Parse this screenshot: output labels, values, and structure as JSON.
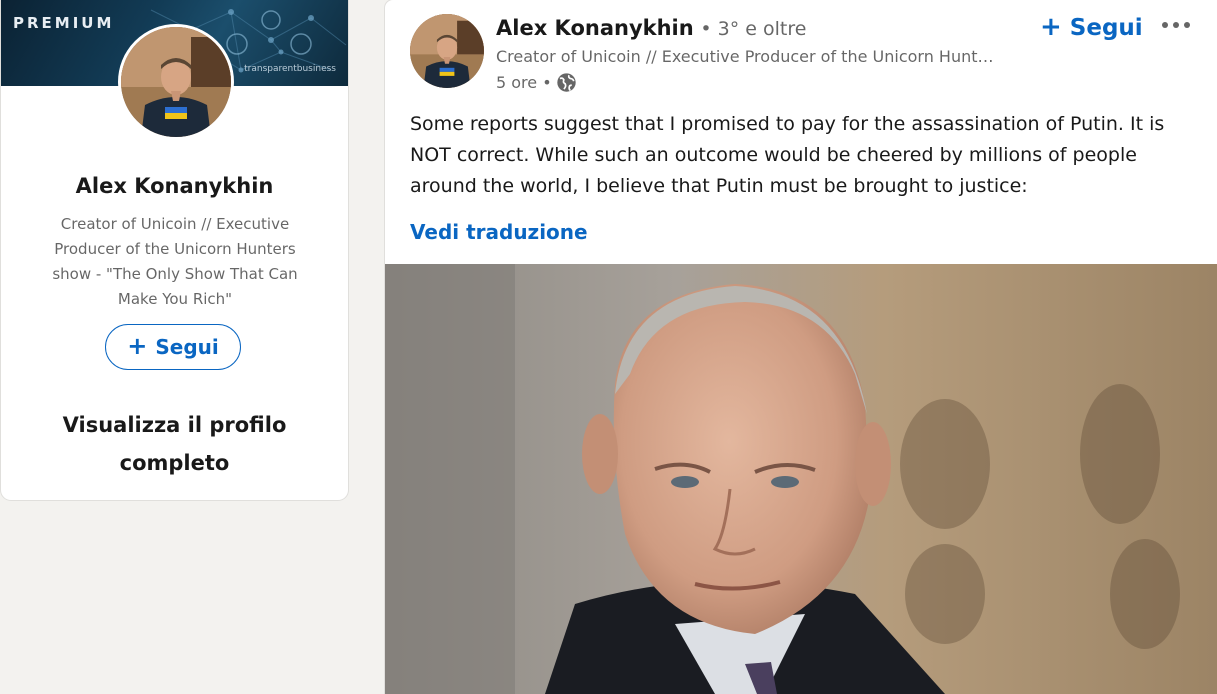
{
  "sidebar_card": {
    "badge": "PREMIUM",
    "banner_brand": "transparentbusiness",
    "name": "Alex Konanykhin",
    "headline": "Creator of Unicoin // Executive Producer of the Unicorn Hunters show - \"The Only Show That Can Make You Rich\"",
    "follow_label": "Segui",
    "view_profile_label": "Visualizza il profilo completo"
  },
  "post": {
    "author_name": "Alex Konanykhin",
    "connection_degree": "• 3° e oltre",
    "author_headline": "Creator of Unicoin // Executive Producer of the Unicorn Hunt…",
    "timestamp": "5 ore •",
    "follow_label": "Segui",
    "body": "Some reports suggest that I promised to pay for the assassination of Putin. It is NOT correct. While such an outcome would be cheered by millions of people around the world, I believe that Putin must be brought to justice:",
    "see_translation_label": "Vedi traduzione"
  },
  "icons": {
    "plus": "+",
    "visibility": "globe-icon",
    "more": "ellipsis-icon"
  },
  "colors": {
    "accent": "#0a66c2",
    "page_background": "#f3f2ef",
    "card_background": "#ffffff"
  }
}
